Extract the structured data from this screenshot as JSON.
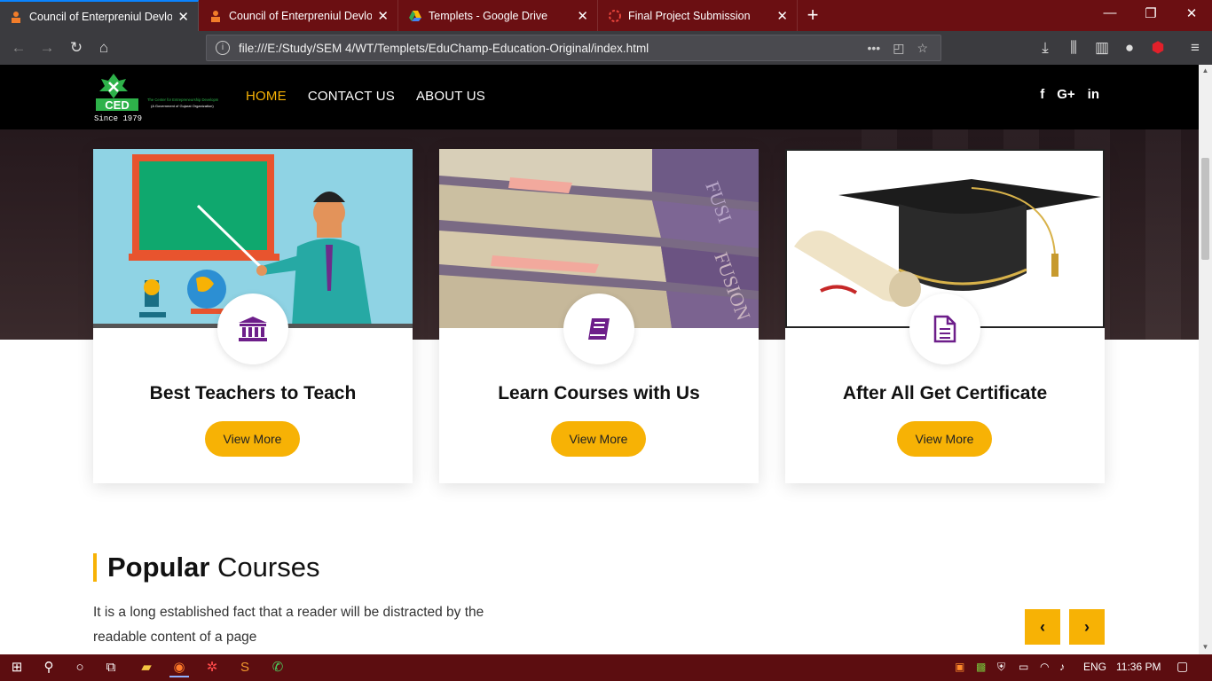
{
  "browser": {
    "tabs": [
      {
        "title": "Council of Enterpreniul Devlop",
        "active": true
      },
      {
        "title": "Council of Enterpreniul Devlop",
        "active": false
      },
      {
        "title": "Templets - Google Drive",
        "active": false
      },
      {
        "title": "Final Project Submission",
        "active": false
      }
    ],
    "url": "file:///E:/Study/SEM 4/WT/Templets/EduChamp-Education-Original/index.html",
    "icons": [
      "back-icon",
      "forward-icon",
      "reload-icon",
      "home-icon",
      "more-icon",
      "pocket-icon",
      "bookmark-star-icon",
      "download-icon",
      "library-icon",
      "sidebar-icon",
      "account-icon",
      "ublock-icon",
      "menu-icon"
    ]
  },
  "site": {
    "logo": {
      "name": "CED",
      "tagline": "The Center for Entrepreneurship Development",
      "subtitle": "(A Government of Gujarat Organization)",
      "since": "Since 1979"
    },
    "menu": [
      "HOME",
      "CONTACT US",
      "ABOUT US"
    ],
    "social": [
      "f",
      "G+",
      "in"
    ],
    "cards": [
      {
        "title": "Best Teachers to Teach",
        "button": "View More",
        "icon": "institution-icon"
      },
      {
        "title": "Learn Courses with Us",
        "button": "View More",
        "icon": "book-icon"
      },
      {
        "title": "After All Get Certificate",
        "button": "View More",
        "icon": "document-icon"
      }
    ],
    "section": {
      "title_bold": "Popular",
      "title_rest": " Courses",
      "description": "It is a long established fact that a reader will be distracted by the readable content of a page",
      "prev": "‹",
      "next": "›"
    },
    "accent_color": "#f7b205"
  },
  "taskbar": {
    "language": "ENG",
    "time": "11:36 PM"
  }
}
